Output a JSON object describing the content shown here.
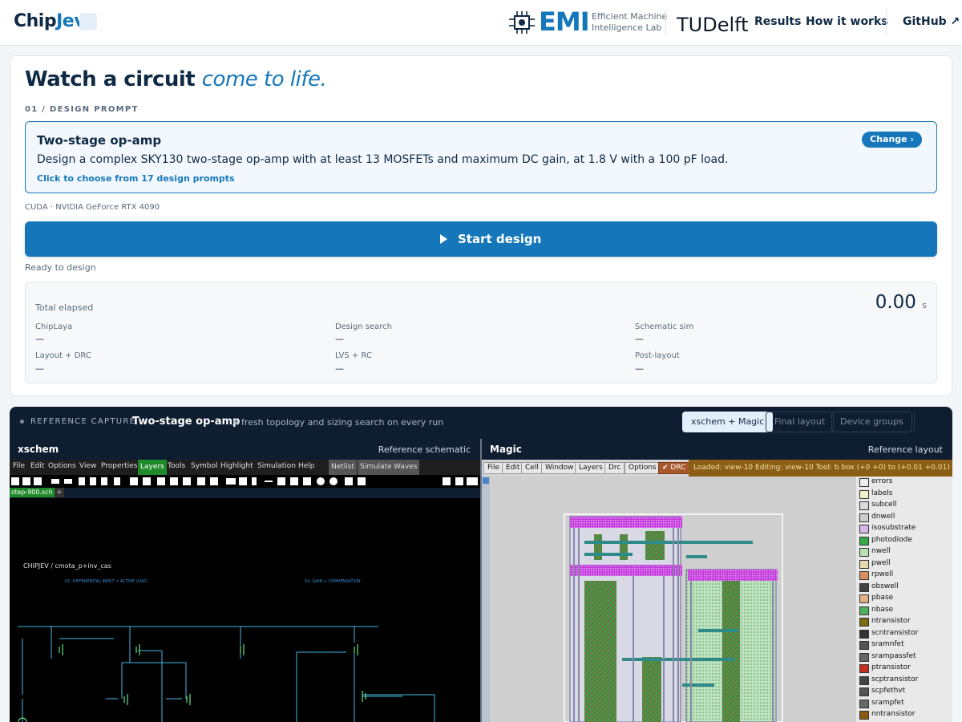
{
  "header": {
    "brand_a": "Chip",
    "brand_b": "Jev",
    "emi": "EMI",
    "emi_sub_1": "Efficient Machine",
    "emi_sub_2": "Intelligence Lab",
    "tudelft": "TUDelft",
    "nav": [
      "Results",
      "How it works",
      "GitHub ↗"
    ]
  },
  "hero": {
    "headline_a": "Watch a circuit ",
    "headline_b": "come to life."
  },
  "prompt": {
    "step_label": "01 / DESIGN PROMPT",
    "title": "Two-stage op-amp",
    "description": "Design a complex SKY130 two-stage op-amp with at least 13 MOSFETs and maximum DC gain, at 1.8 V with a 100 pF load.",
    "hint": "Click to choose from 17 design prompts",
    "change_label": "Change ›"
  },
  "device": "CUDA · NVIDIA GeForce RTX 4090",
  "start_label": "Start design",
  "status": "Ready to design",
  "timing": {
    "total_label": "Total elapsed",
    "total_value": "0.00",
    "total_unit": "s",
    "stages": [
      {
        "label": "ChipLaya",
        "value": "—"
      },
      {
        "label": "Design search",
        "value": "—"
      },
      {
        "label": "Schematic sim",
        "value": "—"
      },
      {
        "label": "Layout + DRC",
        "value": "—"
      },
      {
        "label": "LVS + RC",
        "value": "—"
      },
      {
        "label": "Post-layout",
        "value": "—"
      }
    ]
  },
  "reference": {
    "kicker": "REFERENCE CAPTURE",
    "title": "Two-stage op-amp",
    "subtitle": "A fresh topology and sizing search on every run",
    "tabs": [
      "xschem + Magic",
      "Final layout",
      "Device groups"
    ],
    "left": {
      "name": "xschem",
      "tag": "Reference schematic",
      "menu": [
        "File",
        "Edit",
        "Options",
        "View",
        "Properties",
        "Layers",
        "Tools",
        "Symbol",
        "Highlight",
        "Simulation",
        "Help",
        "Netlist",
        "Simulate",
        "Waves"
      ],
      "file_tab": "step-900.sch",
      "canvas_title": "CHIPJEV / cmota_p+inv_cas",
      "section_1": "01: DIFFERENTIAL INPUT + ACTIVE LOAD",
      "section_2": "02: GAIN + COMPENSATION"
    },
    "right": {
      "name": "Magic",
      "tag": "Reference layout",
      "menu": [
        "File",
        "Edit",
        "Cell",
        "Window",
        "Layers",
        "Drc",
        "Options"
      ],
      "drc": "DRC",
      "status": "Loaded: view-10 Editing: view-10 Tool: b     box (+0 +0) to (+0.01 +0.01) microns",
      "layers": [
        {
          "name": "errors",
          "color": "#eeeeee"
        },
        {
          "name": "labels",
          "color": "#f1f0c8"
        },
        {
          "name": "subcell",
          "color": "#d8d8d8"
        },
        {
          "name": "dnwell",
          "color": "#cfcfcf"
        },
        {
          "name": "isosubstrate",
          "color": "#d8b8e8"
        },
        {
          "name": "photodiode",
          "color": "#3aa94a"
        },
        {
          "name": "nwell",
          "color": "#b8e0b0"
        },
        {
          "name": "pwell",
          "color": "#e8d8b0"
        },
        {
          "name": "rpwell",
          "color": "#d89060"
        },
        {
          "name": "obswell",
          "color": "#444444"
        },
        {
          "name": "pbase",
          "color": "#e0b088"
        },
        {
          "name": "nbase",
          "color": "#50b060"
        },
        {
          "name": "ntransistor",
          "color": "#7a6a10"
        },
        {
          "name": "scntransistor",
          "color": "#333333"
        },
        {
          "name": "sramnfet",
          "color": "#555555"
        },
        {
          "name": "srampassfet",
          "color": "#666666"
        },
        {
          "name": "ptransistor",
          "color": "#c03020"
        },
        {
          "name": "scptransistor",
          "color": "#444444"
        },
        {
          "name": "scpfethvt",
          "color": "#555555"
        },
        {
          "name": "srampfet",
          "color": "#666666"
        },
        {
          "name": "nntransistor",
          "color": "#8a5a10"
        }
      ]
    }
  }
}
